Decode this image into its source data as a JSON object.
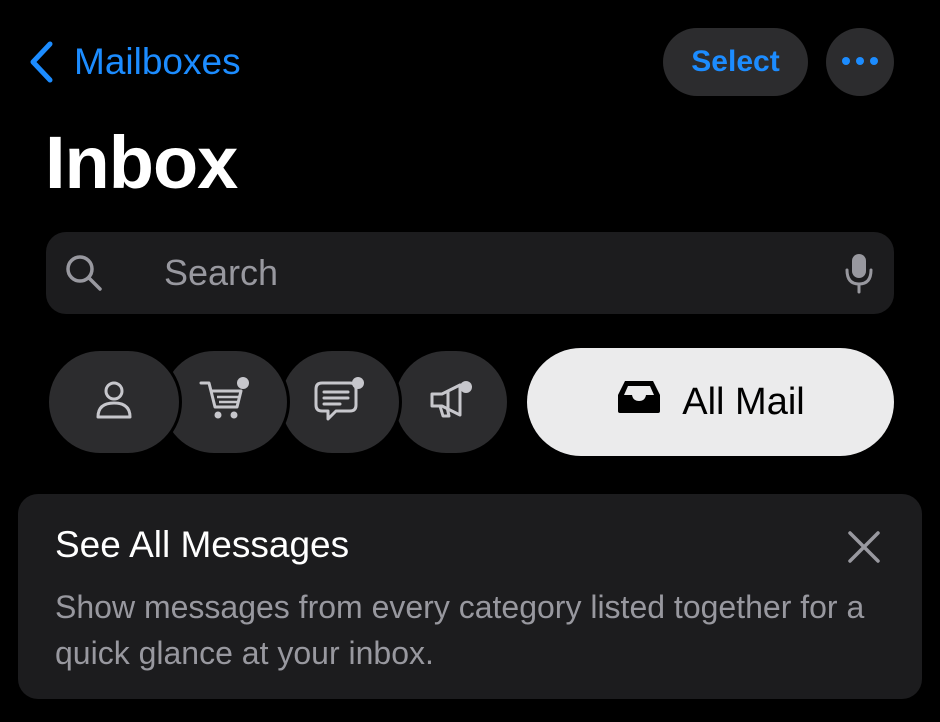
{
  "nav": {
    "back_label": "Mailboxes",
    "select_label": "Select"
  },
  "page": {
    "title": "Inbox"
  },
  "search": {
    "placeholder": "Search"
  },
  "categories": {
    "tabs": [
      {
        "icon": "person-icon",
        "badge": false
      },
      {
        "icon": "shopping-cart-icon",
        "badge": true
      },
      {
        "icon": "chat-bubble-icon",
        "badge": true
      },
      {
        "icon": "megaphone-icon",
        "badge": true
      }
    ],
    "all_mail_label": "All Mail"
  },
  "tip": {
    "title": "See All Messages",
    "body": "Show messages from every category listed together for a quick glance at your inbox."
  },
  "colors": {
    "accent": "#1c8cff",
    "background": "#000000",
    "surface": "#1c1c1e",
    "pill": "#2c2c2e",
    "selected_tab": "#ebebec",
    "secondary_text": "#98989f"
  }
}
